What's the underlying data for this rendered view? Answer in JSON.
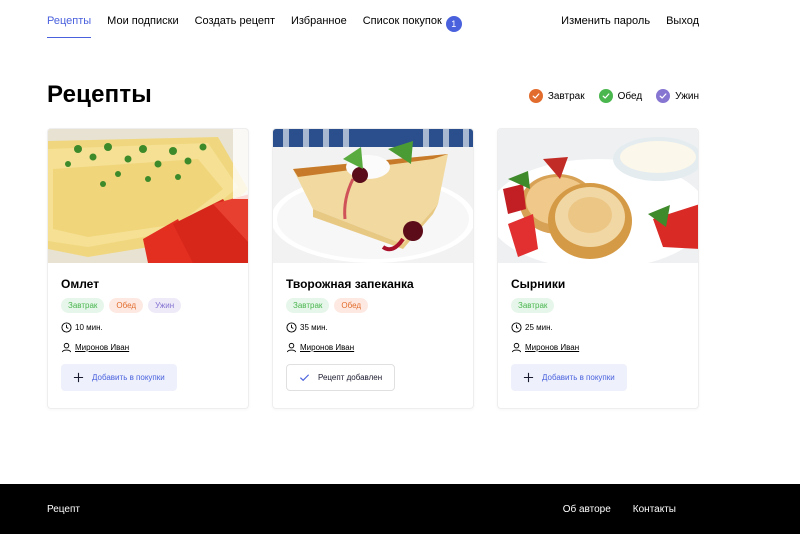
{
  "nav": {
    "items": [
      {
        "label": "Рецепты",
        "active": true
      },
      {
        "label": "Мои подписки"
      },
      {
        "label": "Создать рецепт"
      },
      {
        "label": "Избранное"
      },
      {
        "label": "Список покупок",
        "badge": "1"
      }
    ],
    "right": [
      "Изменить пароль",
      "Выход"
    ]
  },
  "page": {
    "title": "Рецепты"
  },
  "filters": [
    {
      "label": "Завтрак",
      "color": "#e26c2d"
    },
    {
      "label": "Обед",
      "color": "#49b64e"
    },
    {
      "label": "Ужин",
      "color": "#8775d2"
    }
  ],
  "colors": {
    "accent": "#4a61dd",
    "footer_bg": "#000000"
  },
  "cards": [
    {
      "title": "Омлет",
      "tags": [
        "Завтрак",
        "Обед",
        "Ужин"
      ],
      "time": "10 мин.",
      "author": "Миронов Иван",
      "button": "Добавить в покупки",
      "button_state": "add"
    },
    {
      "title": "Творожная запеканка",
      "tags": [
        "Завтрак",
        "Обед"
      ],
      "time": "35 мин.",
      "author": "Миронов Иван",
      "button": "Рецепт добавлен",
      "button_state": "added"
    },
    {
      "title": "Сырники",
      "tags": [
        "Завтрак"
      ],
      "time": "25 мин.",
      "author": "Миронов Иван",
      "button": "Добавить в покупки",
      "button_state": "add"
    }
  ],
  "footer": {
    "brand": "Рецепт",
    "links": [
      "Об авторе",
      "Контакты"
    ]
  }
}
